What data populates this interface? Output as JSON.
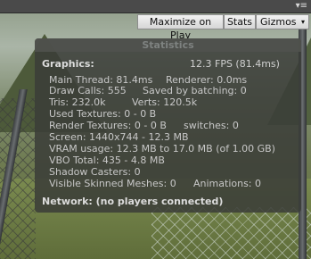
{
  "toolbar": {
    "menu_icon": "menu-icon",
    "menu_glyph": "▾≡"
  },
  "game_bar": {
    "maximize_label": "Maximize on Play",
    "stats_label": "Stats",
    "gizmos_label": "Gizmos",
    "gizmos_caret": "▾"
  },
  "stats": {
    "title": "Statistics",
    "graphics_header": "Graphics:",
    "fps": "12.3 FPS (81.4ms)",
    "main_thread": "Main Thread: 81.4ms",
    "renderer": "Renderer: 0.0ms",
    "draw_calls": "Draw Calls: 555",
    "saved_by_batching": "Saved by batching: 0",
    "tris": "Tris: 232.0k",
    "verts": "Verts: 120.5k",
    "used_textures": "Used Textures: 0 - 0 B",
    "render_textures": "Render Textures: 0 - 0 B",
    "switches": "switches: 0",
    "screen": "Screen: 1440x744 - 12.3 MB",
    "vram": "VRAM usage: 12.3 MB to 17.0 MB (of 1.00 GB)",
    "vbo": "VBO Total: 435 - 4.8 MB",
    "shadow_casters": "Shadow Casters: 0",
    "skinned_meshes": "Visible Skinned Meshes: 0",
    "animations": "Animations: 0",
    "network": "Network: (no players connected)"
  }
}
